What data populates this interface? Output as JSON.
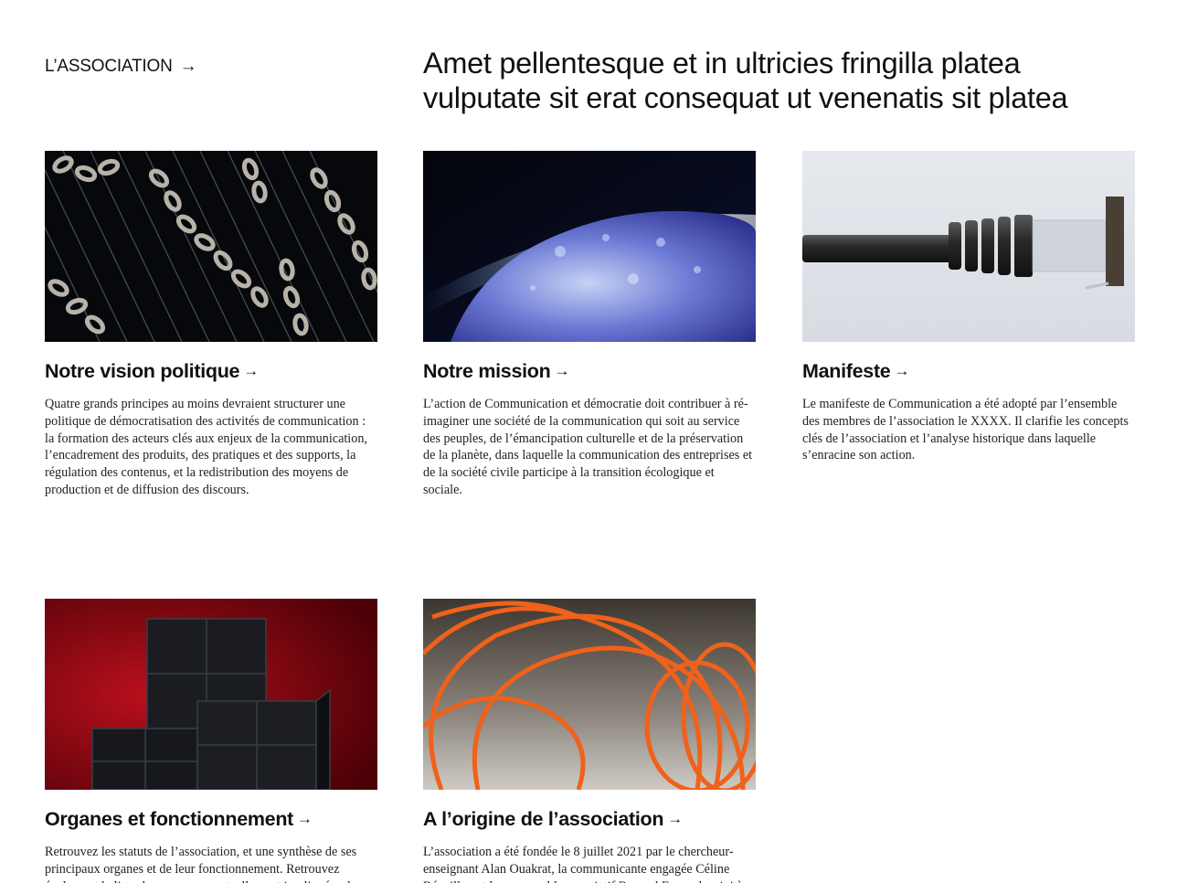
{
  "header": {
    "section_label": "L’ASSOCIATION",
    "section_arrow": "→",
    "headline": "Amet pellentesque et in ultricies fringilla platea vulputate sit erat consequat ut venenatis sit platea"
  },
  "cards": [
    {
      "title": "Notre vision politique",
      "arrow": "→",
      "image_subject": "chains",
      "text": "Quatre grands principes au moins devraient structurer une politique de démocratisation des activités de communication : la formation des acteurs clés aux enjeux de la communication, l’encadrement des produits, des pratiques et des supports, la régulation des contenus, et la redistribution des moyens de production et de diffusion des discours."
    },
    {
      "title": "Notre mission",
      "arrow": "→",
      "image_subject": "ice-planet",
      "text": "L’action de Communication et démocratie doit contribuer à ré-imaginer une société de la communication qui soit au service des peuples, de l’émancipation culturelle et de la préservation de la planète, dans laquelle la communication des entreprises et de la société civile participe à la transition écologique et sociale."
    },
    {
      "title": "Manifeste",
      "arrow": "→",
      "image_subject": "network-cable",
      "text": "Le manifeste de Communication a été adopté par l’ensemble des membres de  l’association le XXXX. Il clarifie les concepts clés de l’association et l’analyse historique dans laquelle s’enracine son action."
    },
    {
      "title": "Organes et fonctionnement",
      "arrow": "→",
      "image_subject": "black-cubes",
      "text": "Retrouvez les statuts de l’association, et une synthèse de ses principaux organes et de leur fonctionnement. Retrouvez également la liste des personnes actuellement impliquées dans les"
    },
    {
      "title": "A l’origine de l’association",
      "arrow": "→",
      "image_subject": "orange-cable-coils",
      "text": "L’association a été fondée le 8 juillet 2021 par le chercheur-enseignant Alan Ouakrat, la communicante engagée Céline Réveillon et le responsable associatif Renaud Fossard, suivi à"
    }
  ],
  "colors": {
    "text": "#111111",
    "background": "#ffffff",
    "body_text": "#222222"
  }
}
